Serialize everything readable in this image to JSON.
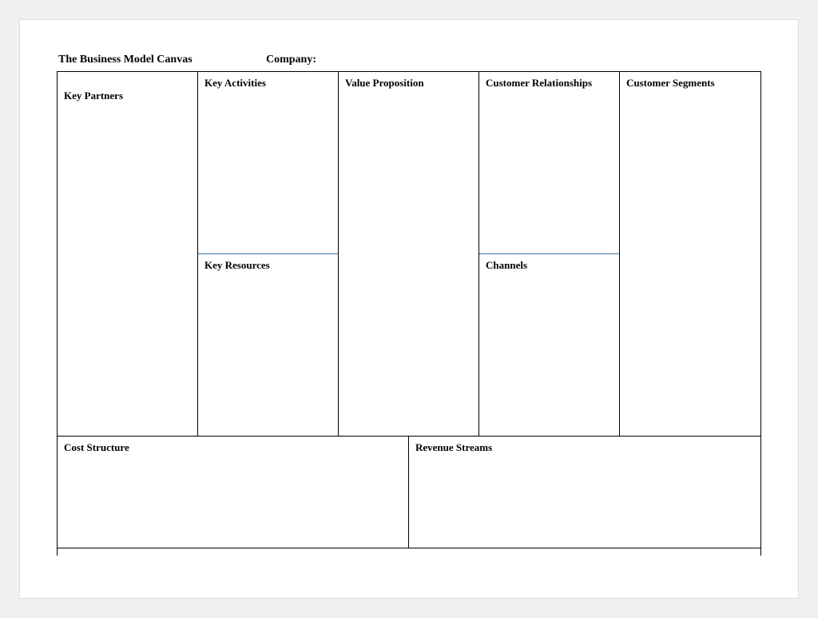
{
  "header": {
    "title": "The Business Model Canvas",
    "company_label": "Company:"
  },
  "cells": {
    "key_partners": "Key Partners",
    "key_activities": "Key Activities",
    "key_resources": "Key Resources",
    "value_proposition": "Value Proposition",
    "customer_relationships": "Customer Relationships",
    "channels": "Channels",
    "customer_segments": "Customer Segments",
    "cost_structure": "Cost Structure",
    "revenue_streams": "Revenue Streams"
  }
}
